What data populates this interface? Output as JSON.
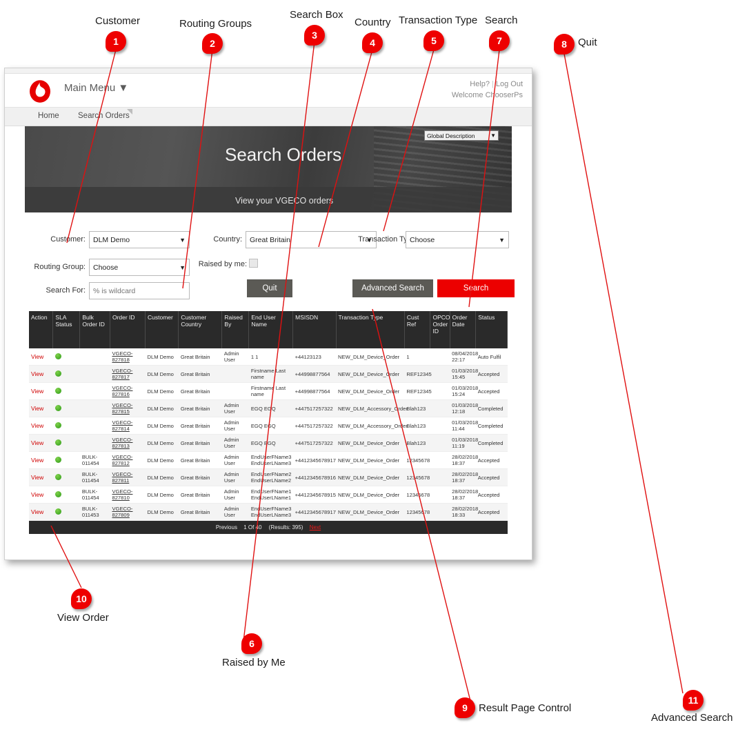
{
  "window": {
    "header": {
      "logo": "vodafone-logo",
      "main_menu": "Main Menu",
      "main_menu_caret": "▼",
      "help": "Help?",
      "separator": "|",
      "logout": "Log Out",
      "welcome": "Welcome ChooserPs"
    },
    "nav": {
      "home": "Home",
      "search_orders": "Search Orders"
    },
    "banner": {
      "title": "Search Orders",
      "subtitle": "View your VGECO orders",
      "global_description": "Global Description",
      "global_description_caret": "▼"
    },
    "form": {
      "customer_label": "Customer:",
      "customer_value": "DLM Demo",
      "routing_group_label": "Routing Group:",
      "routing_group_value": "Choose",
      "search_for_label": "Search For:",
      "search_for_placeholder": "% is wildcard",
      "search_for_value": "",
      "country_label": "Country:",
      "country_value": "Great Britain",
      "transaction_type_label": "Transaction Type:",
      "transaction_type_value": "Choose",
      "raised_by_me_label": "Raised by me:",
      "raised_by_me_checked": false,
      "quit_button": "Quit",
      "advanced_search_button": "Advanced Search",
      "search_button": "Search",
      "caret": "▼"
    },
    "table": {
      "columns": [
        "Action",
        "SLA Status",
        "Bulk Order ID",
        "Order ID",
        "Customer",
        "Customer Country",
        "Raised By",
        "End User Name",
        "MSISDN",
        "Transaction Type",
        "Cust Ref",
        "OPCO Order ID",
        "Order Date",
        "Status"
      ],
      "rows": [
        {
          "action": "View",
          "sla": "green",
          "bulk": "",
          "order_id": "VGECO-827818",
          "customer": "DLM Demo",
          "country": "Great Britain",
          "raised_by": "Admin User",
          "end_user": "1 1",
          "msisdn": "+44123123",
          "txn": "NEW_DLM_Device_Order",
          "cust_ref": "1",
          "opco": "",
          "date": "08/04/2018 22:17",
          "status": "Auto Fulfil"
        },
        {
          "action": "View",
          "sla": "green",
          "bulk": "",
          "order_id": "VGECO-827817",
          "customer": "DLM Demo",
          "country": "Great Britain",
          "raised_by": "",
          "end_user": "Firstname Last name",
          "msisdn": "+44998877564",
          "txn": "NEW_DLM_Device_Order",
          "cust_ref": "REF12345",
          "opco": "",
          "date": "01/03/2018 15:45",
          "status": "Accepted"
        },
        {
          "action": "View",
          "sla": "green",
          "bulk": "",
          "order_id": "VGECO-827816",
          "customer": "DLM Demo",
          "country": "Great Britain",
          "raised_by": "",
          "end_user": "Firstname Last name",
          "msisdn": "+44998877564",
          "txn": "NEW_DLM_Device_Order",
          "cust_ref": "REF12345",
          "opco": "",
          "date": "01/03/2018 15:24",
          "status": "Accepted"
        },
        {
          "action": "View",
          "sla": "green",
          "bulk": "",
          "order_id": "VGECO-827815",
          "customer": "DLM Demo",
          "country": "Great Britain",
          "raised_by": "Admin User",
          "end_user": "EGQ EGQ",
          "msisdn": "+447517257322",
          "txn": "NEW_DLM_Accessory_Order",
          "cust_ref": "Blah123",
          "opco": "",
          "date": "01/03/2018 12:18",
          "status": "Completed"
        },
        {
          "action": "View",
          "sla": "green",
          "bulk": "",
          "order_id": "VGECO-827814",
          "customer": "DLM Demo",
          "country": "Great Britain",
          "raised_by": "Admin User",
          "end_user": "EGQ EGQ",
          "msisdn": "+447517257322",
          "txn": "NEW_DLM_Accessory_Order",
          "cust_ref": "Blah123",
          "opco": "",
          "date": "01/03/2018 11:44",
          "status": "Completed"
        },
        {
          "action": "View",
          "sla": "green",
          "bulk": "",
          "order_id": "VGECO-827813",
          "customer": "DLM Demo",
          "country": "Great Britain",
          "raised_by": "Admin User",
          "end_user": "EGQ EGQ",
          "msisdn": "+447517257322",
          "txn": "NEW_DLM_Device_Order",
          "cust_ref": "Blah123",
          "opco": "",
          "date": "01/03/2018 11:19",
          "status": "Completed"
        },
        {
          "action": "View",
          "sla": "green",
          "bulk": "BULK-011454",
          "order_id": "VGECO-827812",
          "customer": "DLM Demo",
          "country": "Great Britain",
          "raised_by": "Admin User",
          "end_user": "EndUserFName3 EndUserLName3",
          "msisdn": "+4412345678917",
          "txn": "NEW_DLM_Device_Order",
          "cust_ref": "12345678",
          "opco": "",
          "date": "28/02/2018 18:37",
          "status": "Accepted"
        },
        {
          "action": "View",
          "sla": "green",
          "bulk": "BULK-011454",
          "order_id": "VGECO-827811",
          "customer": "DLM Demo",
          "country": "Great Britain",
          "raised_by": "Admin User",
          "end_user": "EndUserFName2 EndUserLName2",
          "msisdn": "+4412345678916",
          "txn": "NEW_DLM_Device_Order",
          "cust_ref": "12345678",
          "opco": "",
          "date": "28/02/2018 18:37",
          "status": "Accepted"
        },
        {
          "action": "View",
          "sla": "green",
          "bulk": "BULK-011454",
          "order_id": "VGECO-827810",
          "customer": "DLM Demo",
          "country": "Great Britain",
          "raised_by": "Admin User",
          "end_user": "EndUserFName1 EndUserLName1",
          "msisdn": "+4412345678915",
          "txn": "NEW_DLM_Device_Order",
          "cust_ref": "12345678",
          "opco": "",
          "date": "28/02/2018 18:37",
          "status": "Accepted"
        },
        {
          "action": "View",
          "sla": "green",
          "bulk": "BULK-011453",
          "order_id": "VGECO-827809",
          "customer": "DLM Demo",
          "country": "Great Britain",
          "raised_by": "Admin User",
          "end_user": "EndUserFName3 EndUserLName3",
          "msisdn": "+4412345678917",
          "txn": "NEW_DLM_Device_Order",
          "cust_ref": "12345678",
          "opco": "",
          "date": "28/02/2018 18:33",
          "status": "Accepted"
        }
      ],
      "pager": {
        "previous": "Previous",
        "page_of": "1 Of 40",
        "results": "(Results: 395)",
        "next": "Next"
      }
    }
  },
  "annotations": [
    {
      "number": "1",
      "label": "Customer"
    },
    {
      "number": "2",
      "label": "Routing Groups"
    },
    {
      "number": "3",
      "label": "Search Box"
    },
    {
      "number": "4",
      "label": "Country"
    },
    {
      "number": "5",
      "label": "Transaction Type"
    },
    {
      "number": "6",
      "label": "Raised by Me"
    },
    {
      "number": "7",
      "label": "Search"
    },
    {
      "number": "8",
      "label": "Quit"
    },
    {
      "number": "9",
      "label": "Result Page Control"
    },
    {
      "number": "10",
      "label": "View Order"
    },
    {
      "number": "11",
      "label": "Advanced Search"
    }
  ],
  "colors": {
    "brand_red": "#e60000",
    "button_red": "#ec0000",
    "button_grey": "#5b5a55",
    "header_dark": "#2a2a2a",
    "annotation_red": "#ee0000",
    "sla_green": "#2d9a18"
  }
}
